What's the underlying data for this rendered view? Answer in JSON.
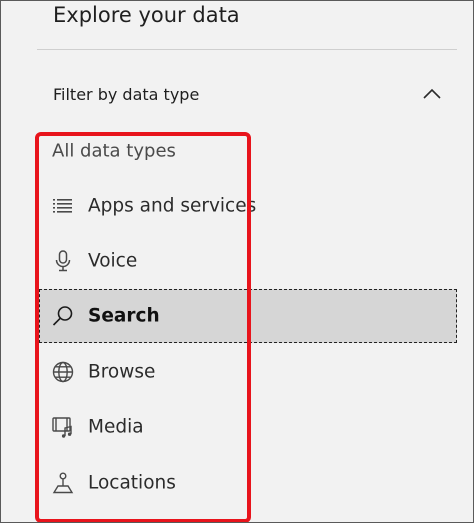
{
  "panel": {
    "title": "Explore your data"
  },
  "filter": {
    "label": "Filter by data type",
    "expanded": true,
    "chevron_icon": "chevron-up-icon"
  },
  "types": {
    "all_label": "All data types",
    "selected": "Search",
    "items": [
      {
        "label": "Apps and services",
        "icon": "list-icon"
      },
      {
        "label": "Voice",
        "icon": "microphone-icon"
      },
      {
        "label": "Search",
        "icon": "search-icon"
      },
      {
        "label": "Browse",
        "icon": "globe-icon"
      },
      {
        "label": "Media",
        "icon": "media-icon"
      },
      {
        "label": "Locations",
        "icon": "location-pin-icon"
      }
    ]
  },
  "annotation": {
    "highlight_color": "#e8141c"
  }
}
